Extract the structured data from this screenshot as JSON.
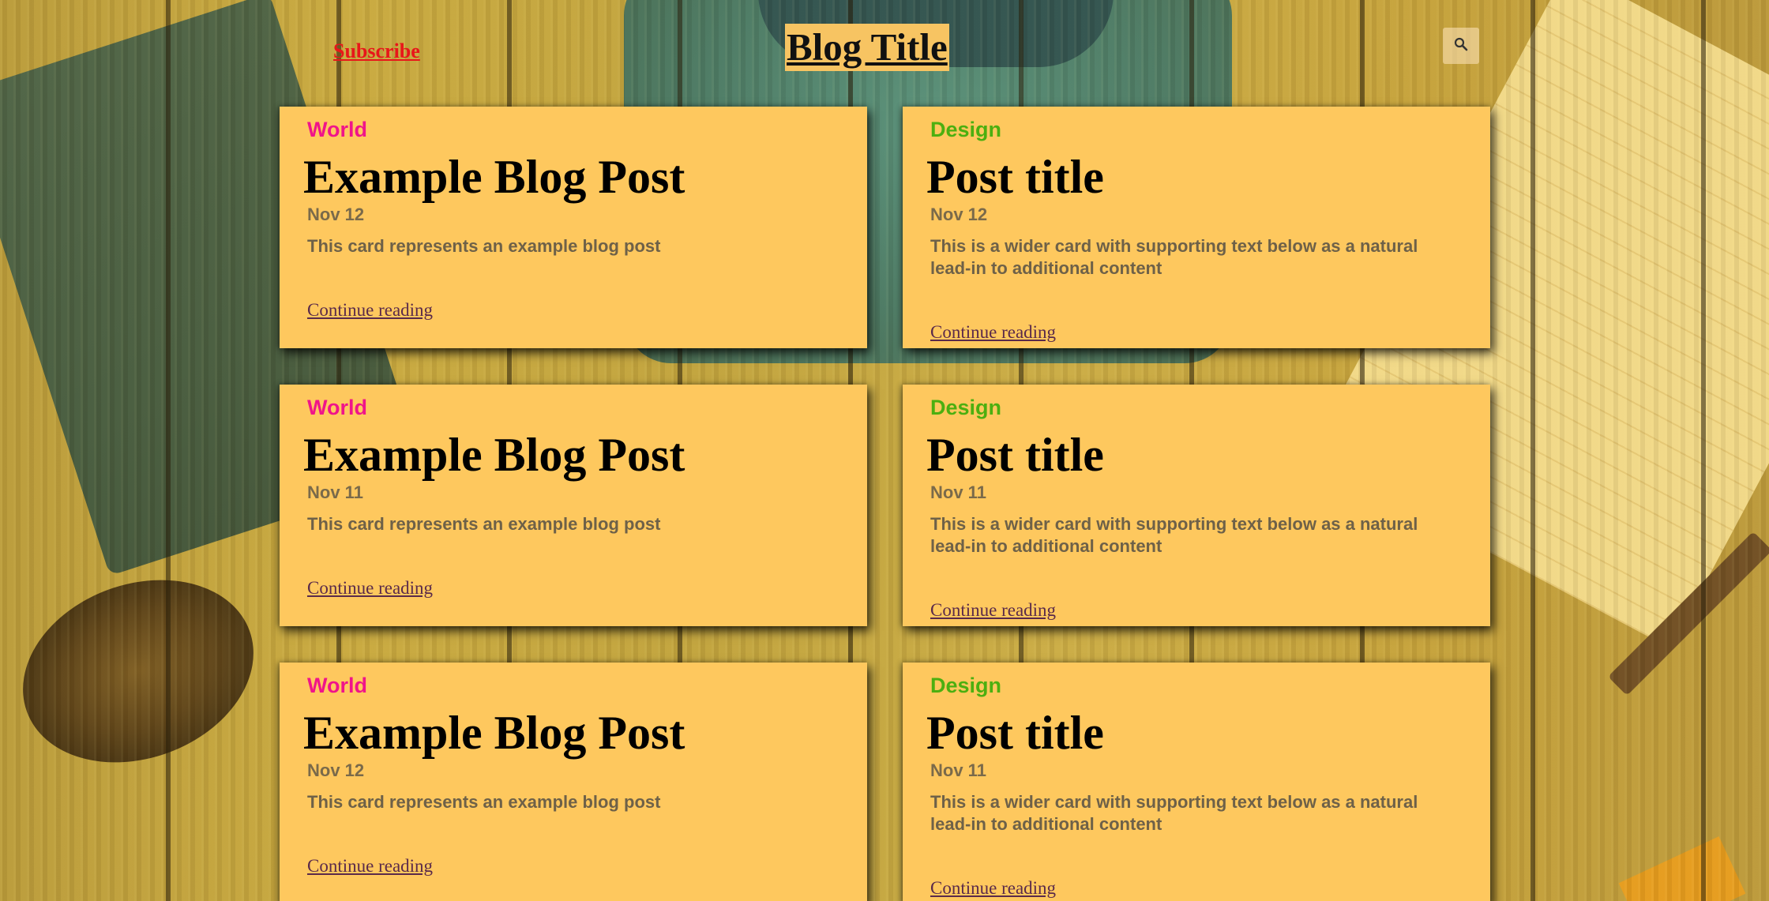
{
  "header": {
    "subscribe_label": "Subscribe",
    "blog_title": "Blog Title",
    "search_icon": "search-icon"
  },
  "colors": {
    "card_background": "#fec85e",
    "subscribe": "#e8161a",
    "category_world": "#f0148a",
    "category_design": "#4caf10"
  },
  "cards": [
    {
      "category": "World",
      "title": "Example Blog Post",
      "date": "Nov 12",
      "excerpt": "This card represents an example blog post",
      "continue_label": "Continue reading"
    },
    {
      "category": "Design",
      "title": "Post title",
      "date": "Nov 12",
      "excerpt": "This is a wider card with supporting text below as a natural lead-in to additional content",
      "continue_label": "Continue reading"
    },
    {
      "category": "World",
      "title": "Example Blog Post",
      "date": "Nov 11",
      "excerpt": "This card represents an example blog post",
      "continue_label": "Continue reading"
    },
    {
      "category": "Design",
      "title": "Post title",
      "date": "Nov 11",
      "excerpt": "This is a wider card with supporting text below as a natural lead-in to additional content",
      "continue_label": "Continue reading"
    },
    {
      "category": "World",
      "title": "Example Blog Post",
      "date": "Nov 12",
      "excerpt": "This card represents an example blog post",
      "continue_label": "Continue reading"
    },
    {
      "category": "Design",
      "title": "Post title",
      "date": "Nov 11",
      "excerpt": "This is a wider card with supporting text below as a natural lead-in to additional content",
      "continue_label": "Continue reading"
    }
  ]
}
